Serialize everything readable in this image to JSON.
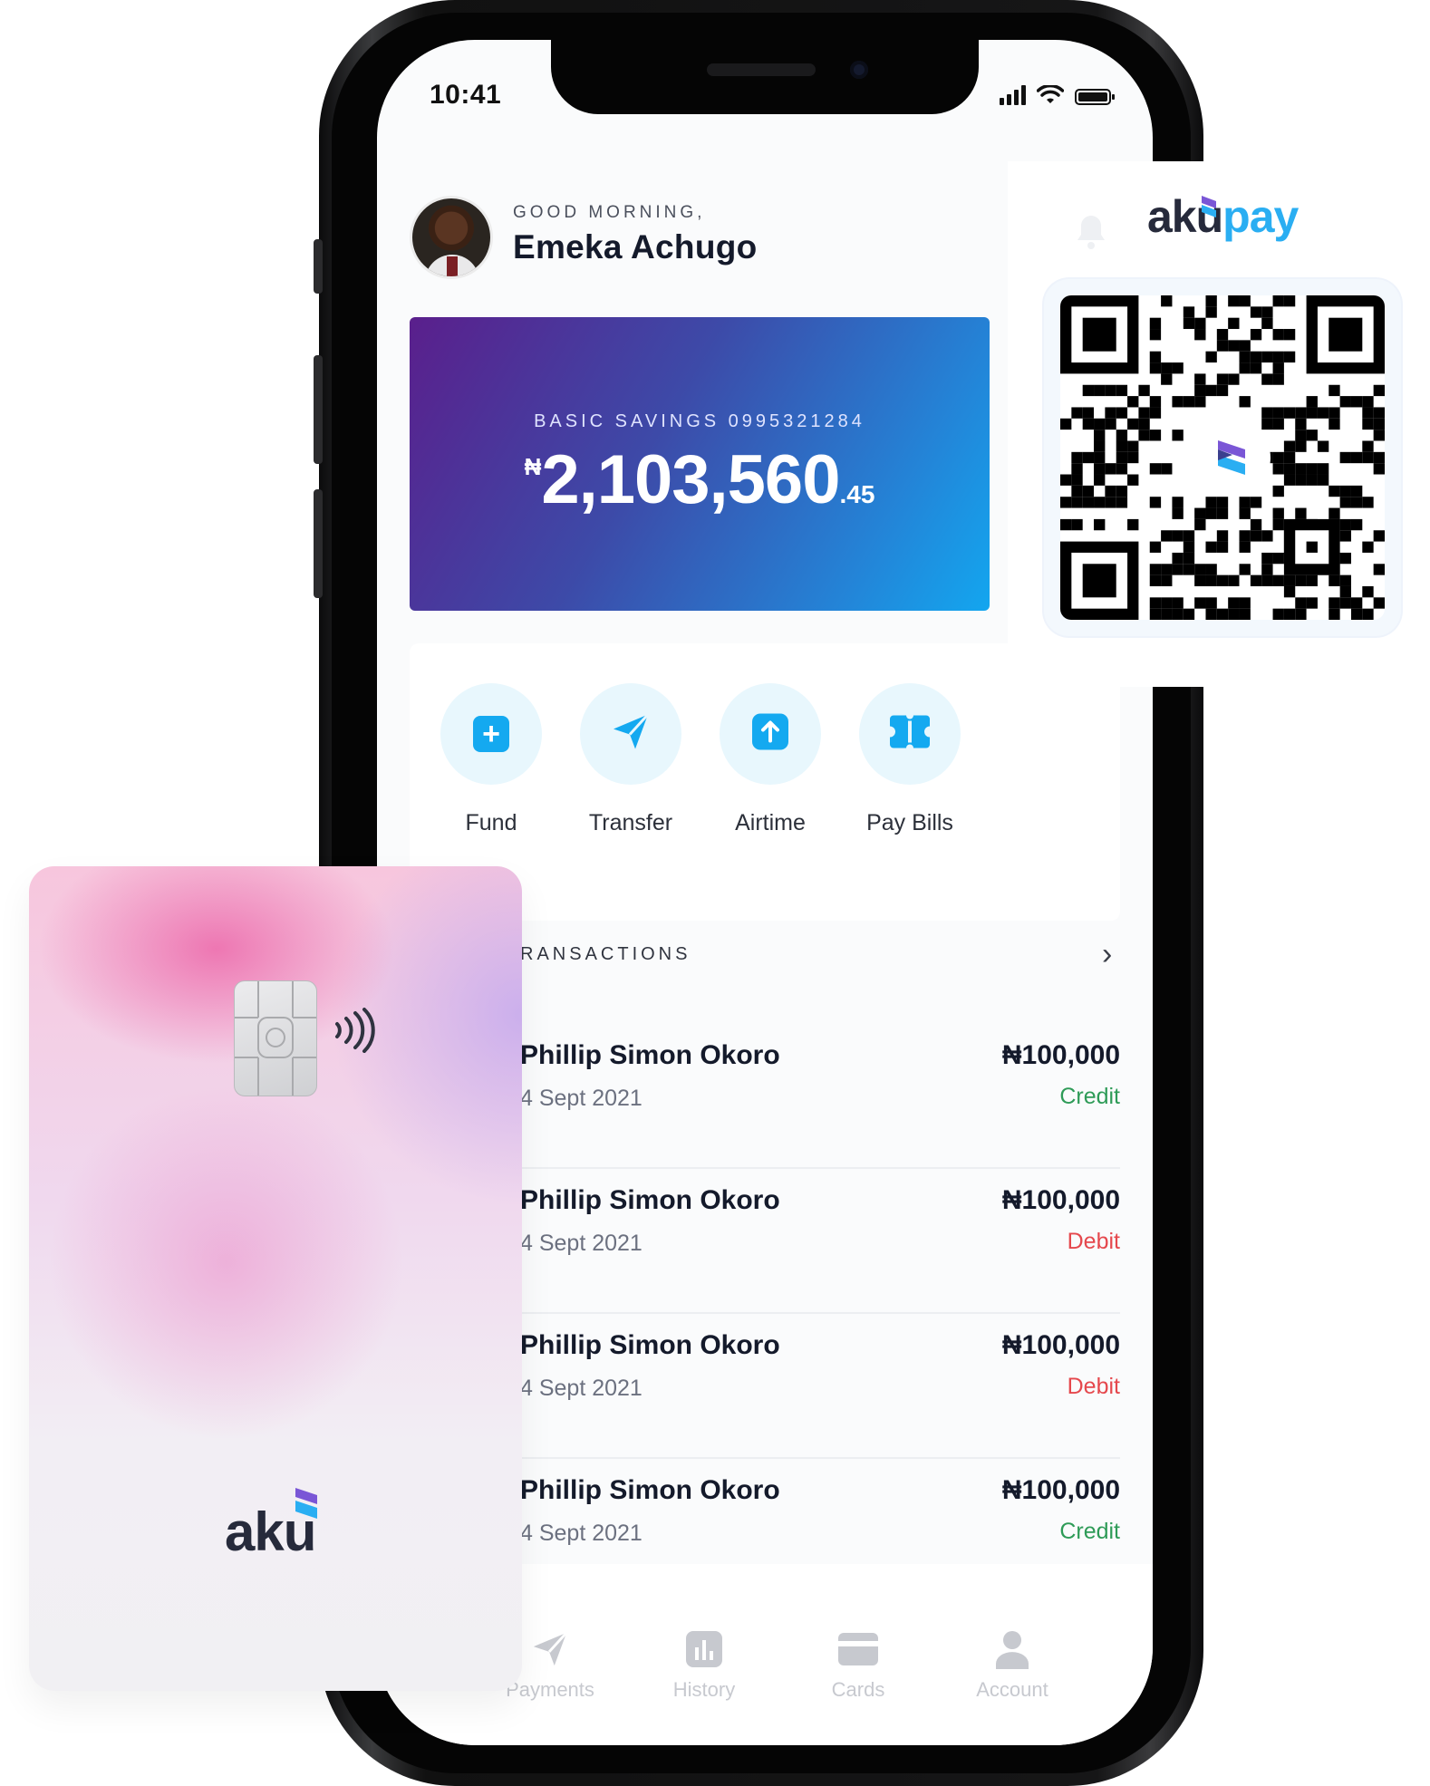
{
  "status": {
    "time": "10:41"
  },
  "greeting": {
    "salutation": "GOOD MORNING,",
    "name": "Emeka Achugo"
  },
  "account": {
    "label": "BASIC SAVINGS 0995321284",
    "currency": "₦",
    "amount_main": "2,103,560",
    "amount_decimal": ".45"
  },
  "actions": [
    {
      "label": "Fund",
      "icon": "plus-icon"
    },
    {
      "label": "Transfer",
      "icon": "send-icon"
    },
    {
      "label": "Airtime",
      "icon": "upload-icon"
    },
    {
      "label": "Pay Bills",
      "icon": "bills-icon"
    }
  ],
  "transactions": {
    "header": "RANSACTIONS",
    "items": [
      {
        "name": "Phillip Simon Okoro",
        "date": "4 Sept 2021",
        "amount": "₦100,000",
        "type": "Credit"
      },
      {
        "name": "Phillip Simon Okoro",
        "date": "4 Sept 2021",
        "amount": "₦100,000",
        "type": "Debit"
      },
      {
        "name": "Phillip Simon Okoro",
        "date": "4 Sept 2021",
        "amount": "₦100,000",
        "type": "Debit"
      },
      {
        "name": "Phillip Simon Okoro",
        "date": "4 Sept 2021",
        "amount": "₦100,000",
        "type": "Credit"
      }
    ]
  },
  "nav": [
    {
      "label": "Payments",
      "icon": "send-icon"
    },
    {
      "label": "History",
      "icon": "chart-icon"
    },
    {
      "label": "Cards",
      "icon": "card-icon"
    },
    {
      "label": "Account",
      "icon": "user-icon"
    }
  ],
  "akupay": {
    "logo_aku": "aku",
    "logo_pay": "pay"
  },
  "card": {
    "logo": "aku"
  },
  "colors": {
    "credit": "#2e9b57",
    "debit": "#e5484d",
    "accent": "#14a9f0",
    "brand_dark": "#262a3b"
  }
}
